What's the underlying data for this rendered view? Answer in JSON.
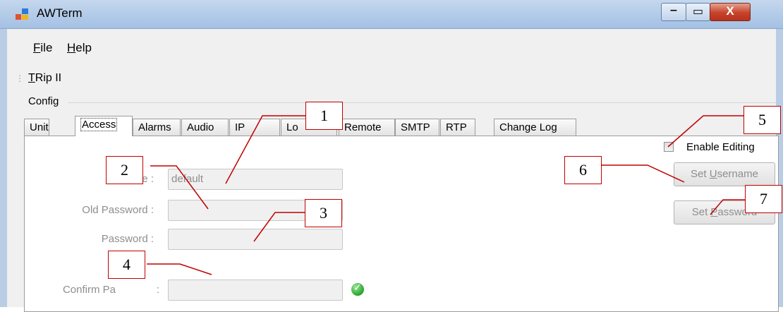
{
  "window": {
    "title": "AWTerm",
    "min_glyph": "‒",
    "max_glyph": "▭",
    "close_glyph": "X"
  },
  "menu": [
    {
      "mnemonic": "F",
      "rest": "ile"
    },
    {
      "mnemonic": "H",
      "rest": "elp"
    }
  ],
  "toolstrip": {
    "mnemonic": "T",
    "rest": "Rip II"
  },
  "config_label": "Config",
  "tabs": [
    "Unit",
    "Access",
    "Alarms",
    "Audio",
    "IP",
    "Lo",
    "Remote",
    "SMTP",
    "RTP",
    "Change Log"
  ],
  "active_tab": "Access",
  "form": {
    "name_label": "Name :",
    "name_value": "default",
    "old_password_label": "Old Password :",
    "password_label": "Password :",
    "confirm_label": "Confirm Pa",
    "confirm_label_end": ":"
  },
  "enable_editing": {
    "label": "Enable Editing",
    "checked": false
  },
  "buttons": {
    "set_username": {
      "pre": "Set ",
      "mnemonic": "U",
      "rest": "sername"
    },
    "set_password": {
      "pre": "Set ",
      "mnemonic": "P",
      "rest": "assword"
    }
  },
  "callouts": [
    "1",
    "2",
    "3",
    "4",
    "5",
    "6",
    "7"
  ],
  "colors": {
    "callout_border": "#c00000",
    "leader_line": "#c00000",
    "titlebar": "#b5cde9"
  }
}
